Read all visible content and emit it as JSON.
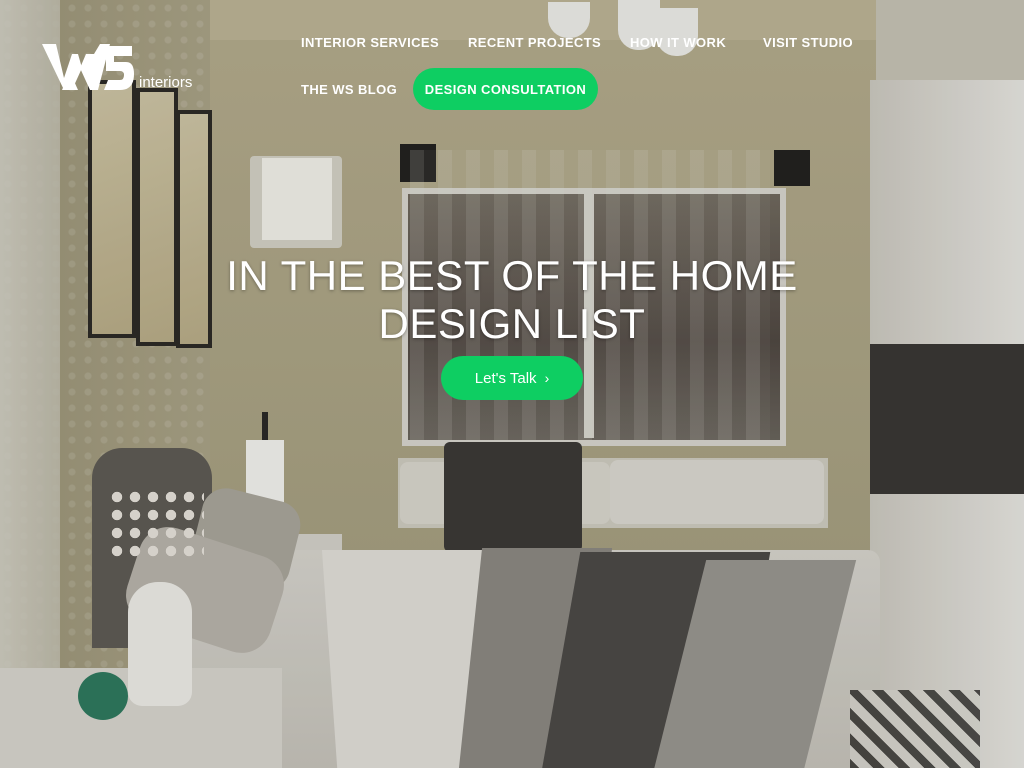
{
  "brand": {
    "logo_mark": "WS",
    "logo_text": "interiors",
    "accent_color": "#0ece62"
  },
  "nav": {
    "items": [
      {
        "label": "INTERIOR SERVICES"
      },
      {
        "label": "RECENT PROJECTS"
      },
      {
        "label": "HOW IT WORK"
      },
      {
        "label": "VISIT STUDIO"
      },
      {
        "label": "THE WS BLOG"
      }
    ],
    "cta_label": "DESIGN CONSULTATION"
  },
  "hero": {
    "title_line1": "IN THE BEST OF THE HOME",
    "title_line2": "DESIGN LIST",
    "cta_label": "Let's Talk",
    "cta_icon": "chevron-right-icon"
  },
  "background": {
    "icon": "bedroom-photo"
  }
}
